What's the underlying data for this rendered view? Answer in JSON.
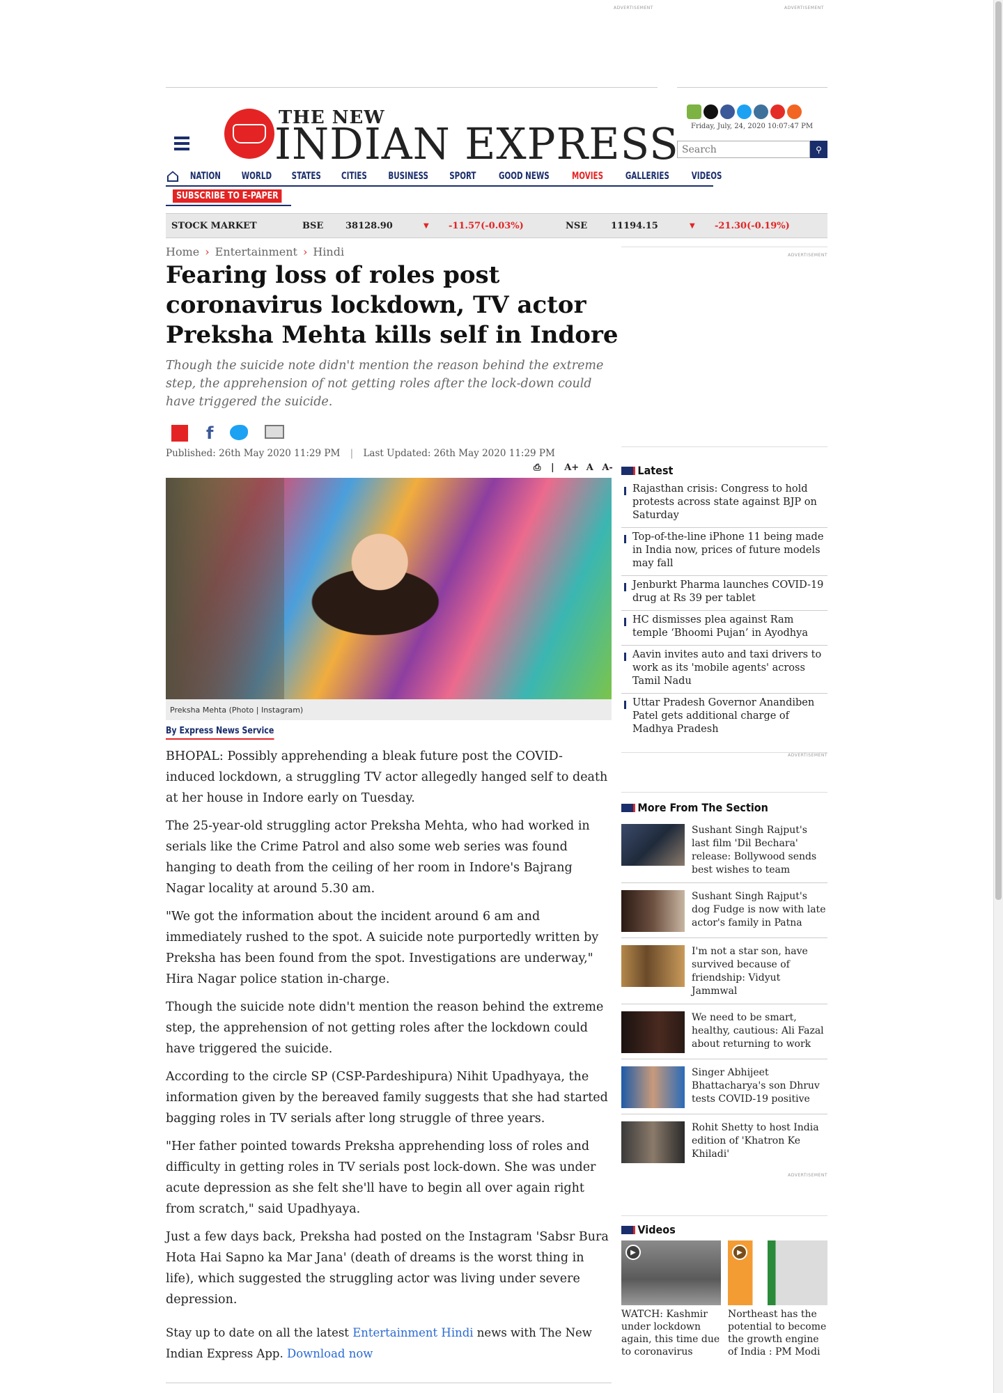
{
  "ads": {
    "label": "ADVERTISEMENT"
  },
  "masthead": {
    "logo_top": "THE NEW",
    "logo_main": "INDIAN EXPRESS",
    "date": "Friday, July, 24, 2020  10:07:47 PM",
    "search_placeholder": "Search",
    "social_icons": [
      "android-icon",
      "apple-icon",
      "facebook-icon",
      "twitter-icon",
      "instagram-icon",
      "youtube-icon",
      "rss-icon"
    ]
  },
  "nav": {
    "items": [
      "NATION",
      "WORLD",
      "STATES",
      "CITIES",
      "BUSINESS",
      "SPORT",
      "GOOD NEWS",
      "MOVIES",
      "GALLERIES",
      "VIDEOS"
    ],
    "active": "MOVIES",
    "subscribe": "SUBSCRIBE TO E-PAPER"
  },
  "stock": {
    "label": "STOCK MARKET",
    "bse_label": "BSE",
    "bse_value": "38128.90",
    "bse_change": "-11.57(-0.03%)",
    "nse_label": "NSE",
    "nse_value": "11194.15",
    "nse_change": "-21.30(-0.19%)"
  },
  "breadcrumb": [
    "Home",
    "Entertainment",
    "Hindi"
  ],
  "article": {
    "title": "Fearing loss of roles post coronavirus lockdown, TV actor Preksha Mehta kills self in Indore",
    "summary": "Though the suicide note didn't mention the reason behind the extreme step, the apprehension of not getting roles after the lock-down could have triggered the suicide.",
    "published": "Published: 26th May 2020 11:29 PM",
    "updated": "Last Updated: 26th May 2020 11:29 PM",
    "font_tools": [
      "A+",
      "A",
      "A-"
    ],
    "caption": "Preksha Mehta (Photo | Instagram)",
    "byline": "By Express News Service",
    "paragraphs": [
      "BHOPAL: Possibly apprehending a bleak future post the COVID-induced lockdown, a struggling TV actor allegedly hanged self to death at her house in Indore early on Tuesday.",
      "The 25-year-old struggling actor Preksha Mehta, who had worked in serials like the Crime Patrol and also some web series was found hanging to death from the ceiling of her room in Indore's Bajrang Nagar locality at around 5.30 am.",
      "\"We got the information about the incident around 6 am and immediately rushed to the spot. A suicide note purportedly written by Preksha has been found from the spot. Investigations are underway,\" Hira Nagar police station in-charge.",
      "Though the suicide note didn't mention the reason behind the extreme step, the apprehension of not getting roles after the lockdown could have triggered the suicide.",
      "According to the circle SP (CSP-Pardeshipura) Nihit Upadhyaya, the information given by the bereaved family suggests that she had started bagging roles in TV serials after long struggle of three years.",
      "\"Her father pointed towards Preksha apprehending loss of roles and difficulty in getting roles in TV serials post lock-down. She was under acute depression as she felt she'll have to begin all over again right from scratch,\" said Upadhyaya.",
      "Just a few days back, Preksha had posted on the Instagram 'Sabsr Bura Hota Hai Sapno ka Mar Jana' (death of dreams is the worst thing in life), which suggested the struggling actor was living under severe depression."
    ],
    "app_prefix": "Stay up to date on all the latest ",
    "app_link": "Entertainment Hindi",
    "app_middle": " news with The New Indian Express App. ",
    "app_download": "Download now"
  },
  "sidebar": {
    "latest_title": "Latest",
    "latest": [
      "Rajasthan crisis: Congress to hold protests across state against BJP on Saturday",
      "Top-of-the-line iPhone 11 being made in India now, prices of future models may fall",
      "Jenburkt Pharma launches COVID-19 drug at Rs 39 per tablet",
      "HC dismisses plea against Ram temple ‘Bhoomi Pujan’ in Ayodhya",
      "Aavin invites auto and taxi drivers to work as its 'mobile agents' across Tamil Nadu",
      "Uttar Pradesh Governor Anandiben Patel gets additional charge of Madhya Pradesh"
    ],
    "more_title": "More From The Section",
    "more": [
      "Sushant Singh Rajput's last film 'Dil Bechara' release: Bollywood sends best wishes to team",
      "Sushant Singh Rajput's dog Fudge is now with late actor's family in Patna",
      "I'm not a star son, have survived because of friendship: Vidyut Jammwal",
      "We need to be smart, healthy, cautious: Ali Fazal about returning to work",
      "Singer Abhijeet Bhattacharya's son Dhruv tests COVID-19 positive",
      "Rohit Shetty to host India edition of 'Khatron Ke Khiladi'"
    ],
    "videos_title": "Videos",
    "videos": [
      "WATCH: Kashmir under lockdown again, this time due to coronavirus",
      "Northeast has the potential to become the growth engine of India : PM Modi"
    ]
  }
}
